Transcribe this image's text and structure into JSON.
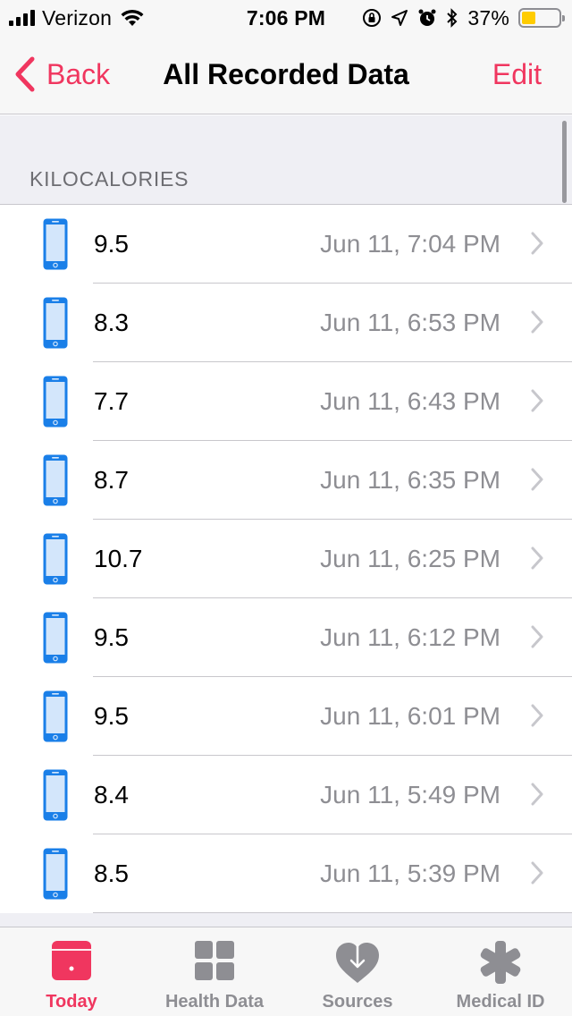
{
  "status_bar": {
    "carrier": "Verizon",
    "time": "7:06 PM",
    "battery_percent": "37%",
    "battery_level": 0.37,
    "battery_color": "#ffcc00"
  },
  "nav": {
    "back_label": "Back",
    "title": "All Recorded Data",
    "edit_label": "Edit",
    "accent_color": "#f0365f"
  },
  "section": {
    "header": "KILOCALORIES"
  },
  "rows": [
    {
      "value": "9.5",
      "date": "Jun 11, 7:04 PM",
      "icon": "iphone-icon"
    },
    {
      "value": "8.3",
      "date": "Jun 11, 6:53 PM",
      "icon": "iphone-icon"
    },
    {
      "value": "7.7",
      "date": "Jun 11, 6:43 PM",
      "icon": "iphone-icon"
    },
    {
      "value": "8.7",
      "date": "Jun 11, 6:35 PM",
      "icon": "iphone-icon"
    },
    {
      "value": "10.7",
      "date": "Jun 11, 6:25 PM",
      "icon": "iphone-icon"
    },
    {
      "value": "9.5",
      "date": "Jun 11, 6:12 PM",
      "icon": "iphone-icon"
    },
    {
      "value": "9.5",
      "date": "Jun 11, 6:01 PM",
      "icon": "iphone-icon"
    },
    {
      "value": "8.4",
      "date": "Jun 11, 5:49 PM",
      "icon": "iphone-icon"
    },
    {
      "value": "8.5",
      "date": "Jun 11, 5:39 PM",
      "icon": "iphone-icon"
    }
  ],
  "tabs": [
    {
      "label": "Today",
      "icon": "today-icon",
      "active": true
    },
    {
      "label": "Health Data",
      "icon": "health-data-icon",
      "active": false
    },
    {
      "label": "Sources",
      "icon": "sources-icon",
      "active": false
    },
    {
      "label": "Medical ID",
      "icon": "medical-id-icon",
      "active": false
    }
  ]
}
